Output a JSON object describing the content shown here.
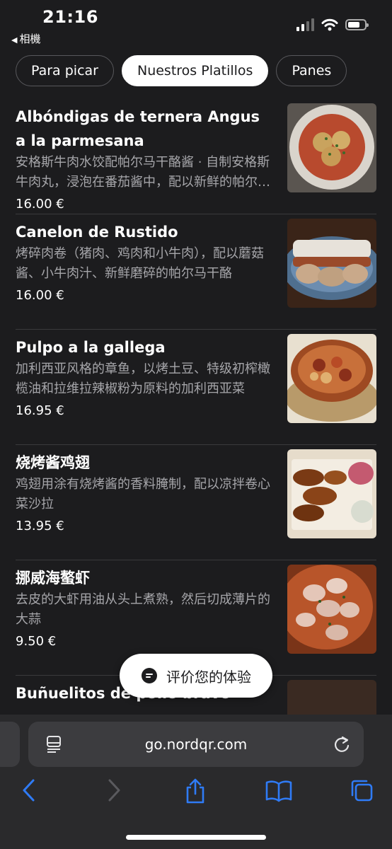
{
  "status_bar": {
    "time": "21:16",
    "back_app": "相機"
  },
  "tabs": [
    {
      "label": "Para picar",
      "active": false
    },
    {
      "label": "Nuestros Platillos",
      "active": true
    },
    {
      "label": "Panes",
      "active": false
    }
  ],
  "menu_items": [
    {
      "name": "Albóndigas de ternera Angus a la parmesana",
      "description": "安格斯牛肉水饺配帕尔马干酪酱 · 自制安格斯牛肉丸，浸泡在番茄酱中，配以新鲜的帕尔马干酪",
      "price": "16.00 €",
      "image": "meatballs-photo"
    },
    {
      "name": "Canelon de Rustido",
      "description": "烤碎肉卷（猪肉、鸡肉和小牛肉），配以蘑菇酱、小牛肉汁、新鲜磨碎的帕尔马干酪",
      "price": "16.00 €",
      "image": "cannelloni-photo"
    },
    {
      "name": "Pulpo a la gallega",
      "description": "加利西亚风格的章鱼，以烤土豆、特级初榨橄榄油和拉维拉辣椒粉为原料的加利西亚菜",
      "price": "16.95 €",
      "image": "octopus-photo"
    },
    {
      "name": "烧烤酱鸡翅",
      "description": "鸡翅用涂有烧烤酱的香料腌制，配以凉拌卷心菜沙拉",
      "price": "13.95 €",
      "image": "chicken-wings-photo"
    },
    {
      "name": "挪威海螯虾",
      "description": "去皮的大虾用油从头上煮熟，然后切成薄片的大蒜",
      "price": "9.50 €",
      "image": "prawns-photo"
    },
    {
      "name": "Buñuelitos de pollo bravo",
      "description": "",
      "price": "",
      "image": "next-dish-photo"
    }
  ],
  "feedback_button": {
    "label": "评价您的体验",
    "icon": "chat-bubble-icon"
  },
  "browser": {
    "url": "go.nordqr.com",
    "toolbar_icons": [
      "back-icon",
      "forward-icon",
      "share-icon",
      "bookmarks-icon",
      "tabs-icon"
    ],
    "accent": "#2f7bf6"
  }
}
